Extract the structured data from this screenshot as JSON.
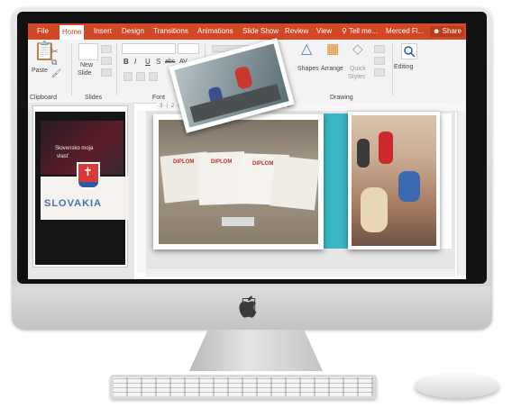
{
  "colors": {
    "accent": "#d24726",
    "ribbon": "#f3f3f3",
    "teal": "#3bb6c4",
    "coral": "#f07a5a"
  },
  "tabs": [
    "File",
    "Home",
    "Insert",
    "Design",
    "Transitions",
    "Animations",
    "Slide Show",
    "Review",
    "View"
  ],
  "active_tab": "Home",
  "tell_me": "Tell me...",
  "user": "Merced Fl...",
  "share": "Share",
  "ribbon": {
    "paste": "Paste",
    "new_slide_1": "New",
    "new_slide_2": "Slide",
    "shapes": "Shapes",
    "arrange": "Arrange",
    "quick_1": "Quick",
    "quick_2": "Styles",
    "editing": "Editing",
    "groups": {
      "clipboard": "Clipboard",
      "slides": "Slides",
      "font": "Font",
      "drawing": "Drawing"
    },
    "font_btns": [
      "B",
      "I",
      "U",
      "S",
      "abc",
      "AV"
    ]
  },
  "ruler_text": "·3·|·2·|·1·|·0·|·1·|·2·|·3·|·4·|·5·|·6·|·7·|·8·",
  "thumbnail_photo": {
    "line1": "Slovensko moja",
    "line2": "vlasť",
    "word": "SLOVAKIA"
  },
  "diplomas": {
    "title": "DIPLOM",
    "count": 4
  },
  "icons": {
    "apple": "apple-logo-icon",
    "search": "search-icon",
    "user": "person-icon",
    "bulb": "lightbulb-icon"
  }
}
